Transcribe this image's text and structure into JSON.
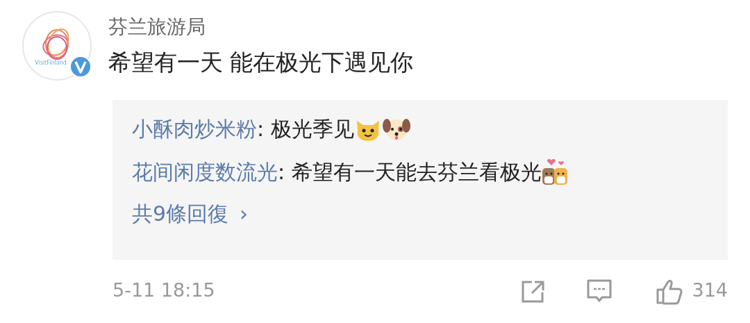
{
  "author": {
    "name": "芬兰旅游局",
    "logo_text": "VisitFinland",
    "verified": true
  },
  "content": "希望有一天 能在极光下遇见你",
  "replies": [
    {
      "user": "小酥肉炒米粉",
      "text": ": 极光季见",
      "stickers": [
        {
          "kind": "cat"
        },
        {
          "kind": "dog"
        }
      ]
    },
    {
      "user": "花间闲度数流光",
      "text": ": 希望有一天能去芬兰看极光",
      "stickers": [
        {
          "kind": "dogs"
        }
      ]
    }
  ],
  "more_replies": "共9條回復",
  "more_arrow": "›",
  "time": "5-11 18:15",
  "likes": "314"
}
